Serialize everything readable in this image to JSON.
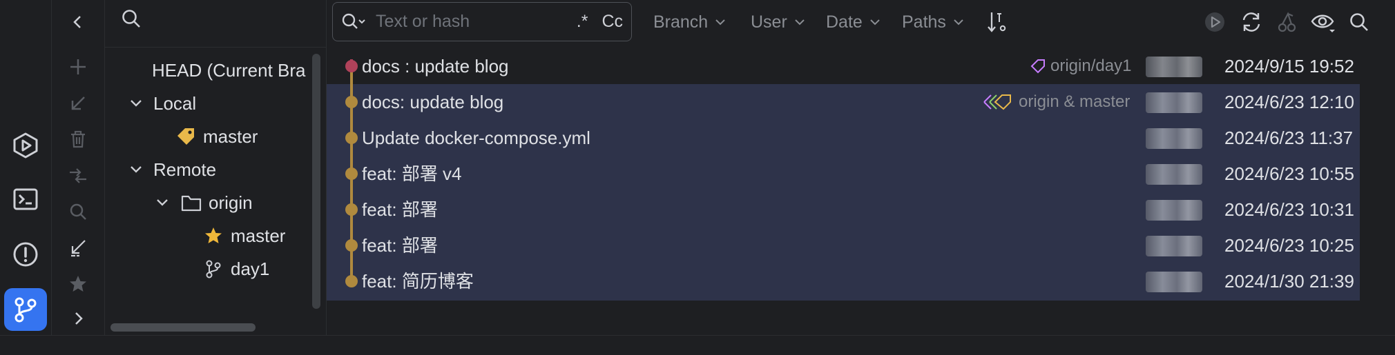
{
  "colors": {
    "accent": "#3574f0",
    "selection": "#2e334a",
    "graph_branch": "#b08a3e",
    "graph_head": "#b0425a",
    "tag_purple": "#c77dff",
    "tag_yellow": "#e8b84a",
    "star": "#f0b83a"
  },
  "activity_bar": [
    {
      "icon": "run-icon"
    },
    {
      "icon": "terminal-icon"
    },
    {
      "icon": "problems-icon"
    },
    {
      "icon": "git-icon",
      "active": true
    }
  ],
  "tool_strip": [
    {
      "icon": "collapse-left-icon"
    },
    {
      "icon": "add-icon"
    },
    {
      "icon": "checkout-icon"
    },
    {
      "icon": "delete-icon"
    },
    {
      "icon": "merge-icon"
    },
    {
      "icon": "search-icon"
    },
    {
      "icon": "update-icon"
    },
    {
      "icon": "favorite-icon"
    },
    {
      "icon": "expand-icon"
    }
  ],
  "tree": {
    "head": "HEAD (Current Bra",
    "local": "Local",
    "local_master": "master",
    "remote": "Remote",
    "origin": "origin",
    "origin_master": "master",
    "origin_day1": "day1"
  },
  "log_toolbar": {
    "search_placeholder": "Text or hash",
    "regex": ".*",
    "match_case": "Cc",
    "filters": [
      "Branch",
      "User",
      "Date",
      "Paths"
    ]
  },
  "commits": [
    {
      "message": "docs : update blog",
      "refs": "origin/day1",
      "date": "2024/9/15 19:52",
      "selected": false
    },
    {
      "message": "docs: update blog",
      "refs": "origin & master",
      "date": "2024/6/23 12:10",
      "selected": true
    },
    {
      "message": "Update docker-compose.yml",
      "refs": "",
      "date": "2024/6/23 11:37",
      "selected": true
    },
    {
      "message": "feat: 部署 v4",
      "refs": "",
      "date": "2024/6/23 10:55",
      "selected": true
    },
    {
      "message": "feat: 部署",
      "refs": "",
      "date": "2024/6/23 10:31",
      "selected": true
    },
    {
      "message": "feat: 部署",
      "refs": "",
      "date": "2024/6/23 10:25",
      "selected": true
    },
    {
      "message": "feat: 简历博客",
      "refs": "",
      "date": "2024/1/30 21:39",
      "selected": true
    }
  ]
}
